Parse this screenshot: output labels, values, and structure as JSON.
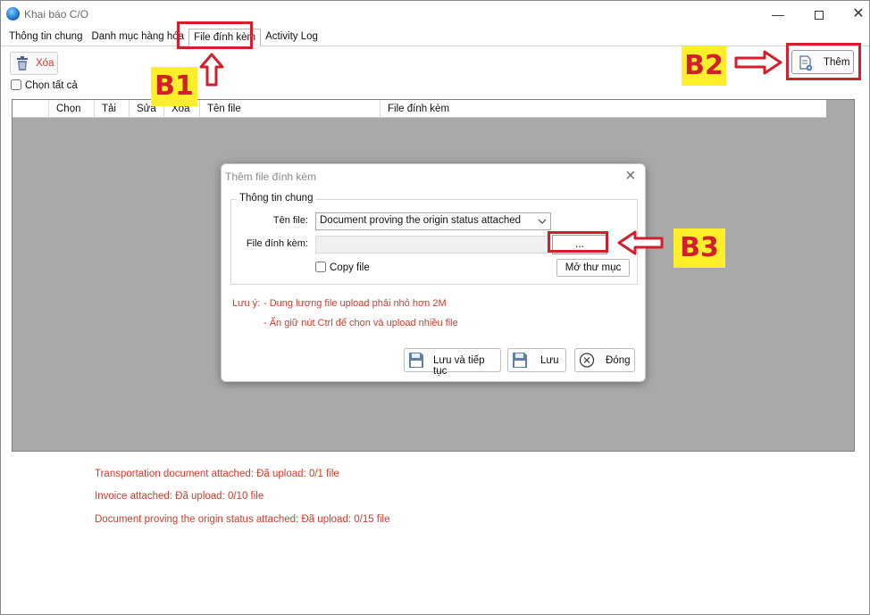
{
  "window": {
    "title": "Khai báo C/O",
    "min_glyph": "—",
    "close_glyph": "✕"
  },
  "tabs": [
    {
      "label": "Thông tin chung"
    },
    {
      "label": "Danh mục hàng hóa"
    },
    {
      "label": "File đính kèm",
      "active": true
    },
    {
      "label": "Activity Log"
    }
  ],
  "toolbar": {
    "delete_label": "Xóa",
    "select_all_label": "Chọn tất cả",
    "add_label": "Thêm"
  },
  "annotations": {
    "b1": "B1",
    "b2": "B2",
    "b3": "B3",
    "color": "#d11f2c",
    "badge_bg": "#ffef2a"
  },
  "grid": {
    "columns": [
      "",
      "Chọn",
      "Tải",
      "Sửa",
      "Xóa",
      "Tên file",
      "File đính kèm"
    ]
  },
  "dialog": {
    "title": "Thêm file đính kèm",
    "group_title": "Thông tin chung",
    "file_name_label": "Tên file:",
    "file_name_value": "Document proving the origin status attached",
    "attach_label": "File đính kèm:",
    "attach_value": "",
    "browse_label": "...",
    "copy_file_label": "Copy file",
    "open_folder_label": "Mở thư mục",
    "note_prefix": "Lưu ý:",
    "note_1": "- Dung lượng file upload phải nhỏ hơn 2M",
    "note_2": "- Ấn giữ nút Ctrl để chọn và upload nhiều file",
    "save_continue_label": "Lưu và tiếp tục",
    "save_label": "Lưu",
    "close_label": "Đóng"
  },
  "upload_status": [
    "Transportation document attached: Đã upload: 0/1 file",
    "Invoice attached: Đã upload: 0/10 file",
    "Document proving the origin status attached: Đã upload: 0/15 file"
  ],
  "icons": {
    "app": "globe-icon",
    "trash": "trash-icon",
    "add": "document-add-icon",
    "save": "floppy-disk-icon",
    "close": "circle-x-icon",
    "dropdown": "chevron-down-icon"
  }
}
